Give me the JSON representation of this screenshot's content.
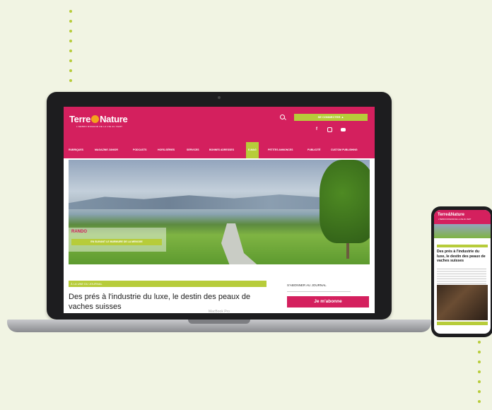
{
  "site": {
    "logo_part1": "Terre",
    "logo_part2": "Nature",
    "tagline": "L'HEBDO ROMAND DE LA VIE AU VERT",
    "login_button": "SE CONNECTER ▲",
    "social_icons": [
      "facebook-icon",
      "instagram-icon",
      "youtube-icon"
    ]
  },
  "nav": {
    "items": [
      "RUBRIQUES",
      "MAGAZINE JUNIOR",
      "PODCASTS",
      "HORS-SÉRIES",
      "SERVICES",
      "BONNES ADRESSES",
      "E-MAG",
      "PETITES ANNONCES",
      "PUBLICITÉ",
      "CUSTOM PUBLISHING"
    ],
    "active": "E-MAG"
  },
  "hero": {
    "category": "RANDO",
    "link": "EN SUIVANT LE MURMURE DE LA MENOGE",
    "dots": 8,
    "active_dot": 6
  },
  "article": {
    "tag": "À LA UNE DU JOURNAL",
    "headline": "Des prés à l'industrie du luxe, le destin des peaux de vaches suisses"
  },
  "subscribe": {
    "label": "S'ABONNER AU JOURNAL",
    "button": "Je m'abonne"
  },
  "device": {
    "laptop_label": "MacBook Pro"
  },
  "phone": {
    "logo": "Terre&Nature",
    "tagline": "L'HEBDO ROMAND DE LA VIE AU VERT",
    "headline": "Des prés à l'industrie du luxe, le destin des peaux de vaches suisses"
  },
  "colors": {
    "brand": "#d4205e",
    "accent": "#b7cc3a",
    "background": "#f1f4e3"
  }
}
